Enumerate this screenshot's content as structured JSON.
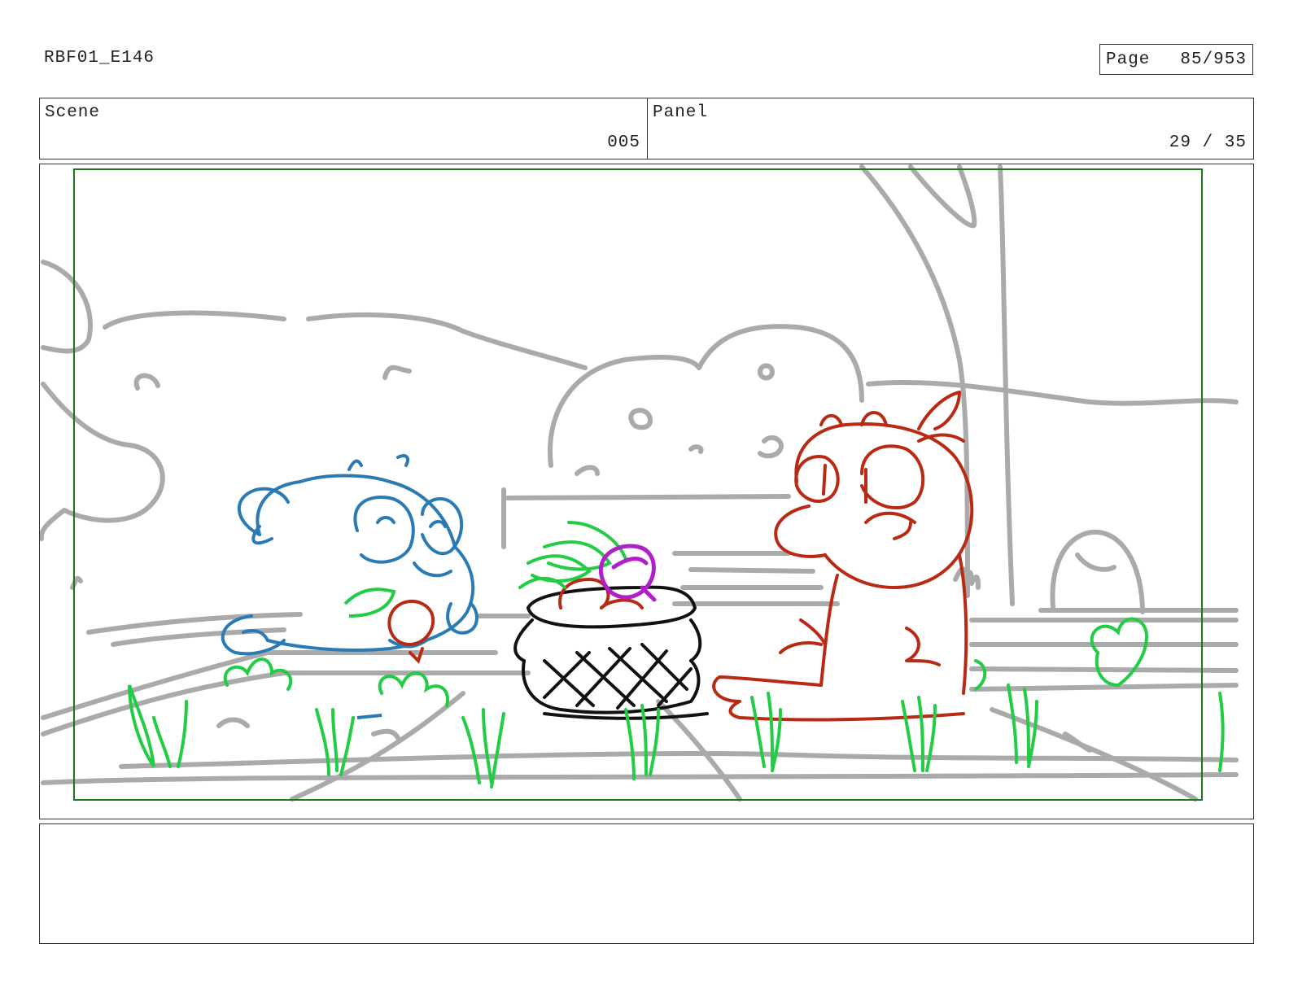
{
  "header": {
    "doc_id": "RBF01_E146",
    "page_label": "Page",
    "page_value": "85/953"
  },
  "scene": {
    "label": "Scene",
    "value": "005"
  },
  "panel": {
    "label": "Panel",
    "value": "29 / 35"
  },
  "drawing": {
    "description_colors": {
      "background": "#aaaaaa",
      "safe_frame": "#1a7a1a",
      "blue_character": "#2a7ab5",
      "red_character": "#b82a14",
      "grass": "#22cc44",
      "basket": "#111111",
      "onion": "#b020c8"
    }
  },
  "notes": {
    "text": ""
  }
}
